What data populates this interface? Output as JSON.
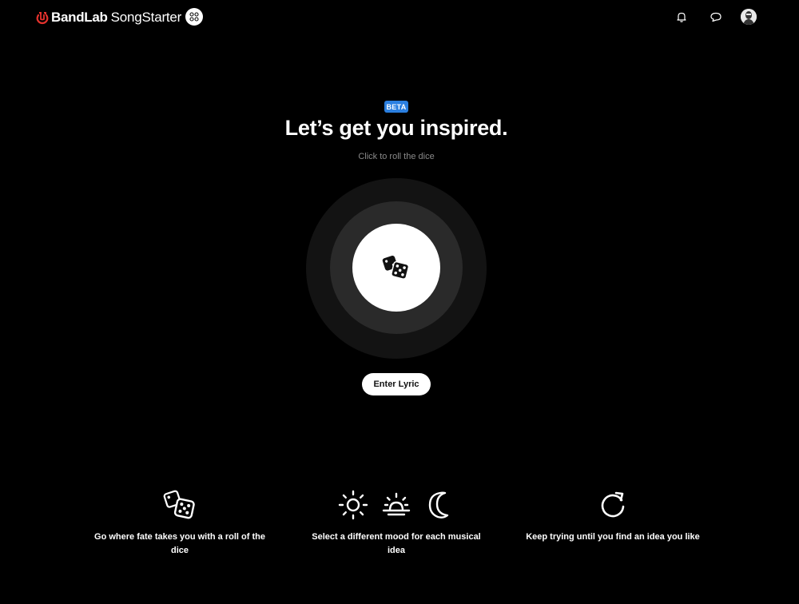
{
  "header": {
    "brand_name": "BandLab",
    "product_name": "SongStarter",
    "icons": [
      "apps-icon",
      "bell-icon",
      "chat-icon",
      "avatar"
    ]
  },
  "hero": {
    "badge": "BETA",
    "title": "Let’s get you inspired.",
    "subtitle": "Click to roll the dice"
  },
  "actions": {
    "enter_lyric": "Enter Lyric"
  },
  "features": [
    {
      "icons": [
        "dice-icon"
      ],
      "text": "Go where fate takes you with a roll of the dice"
    },
    {
      "icons": [
        "sun-icon",
        "sunrise-icon",
        "moon-icon"
      ],
      "text": "Select a different mood for each musical idea"
    },
    {
      "icons": [
        "refresh-icon"
      ],
      "text": "Keep trying until you find an idea you like"
    }
  ],
  "colors": {
    "background": "#000000",
    "brand_red": "#e5322d",
    "beta_blue": "#2b7fe0",
    "muted_text": "#8a8a8a"
  }
}
